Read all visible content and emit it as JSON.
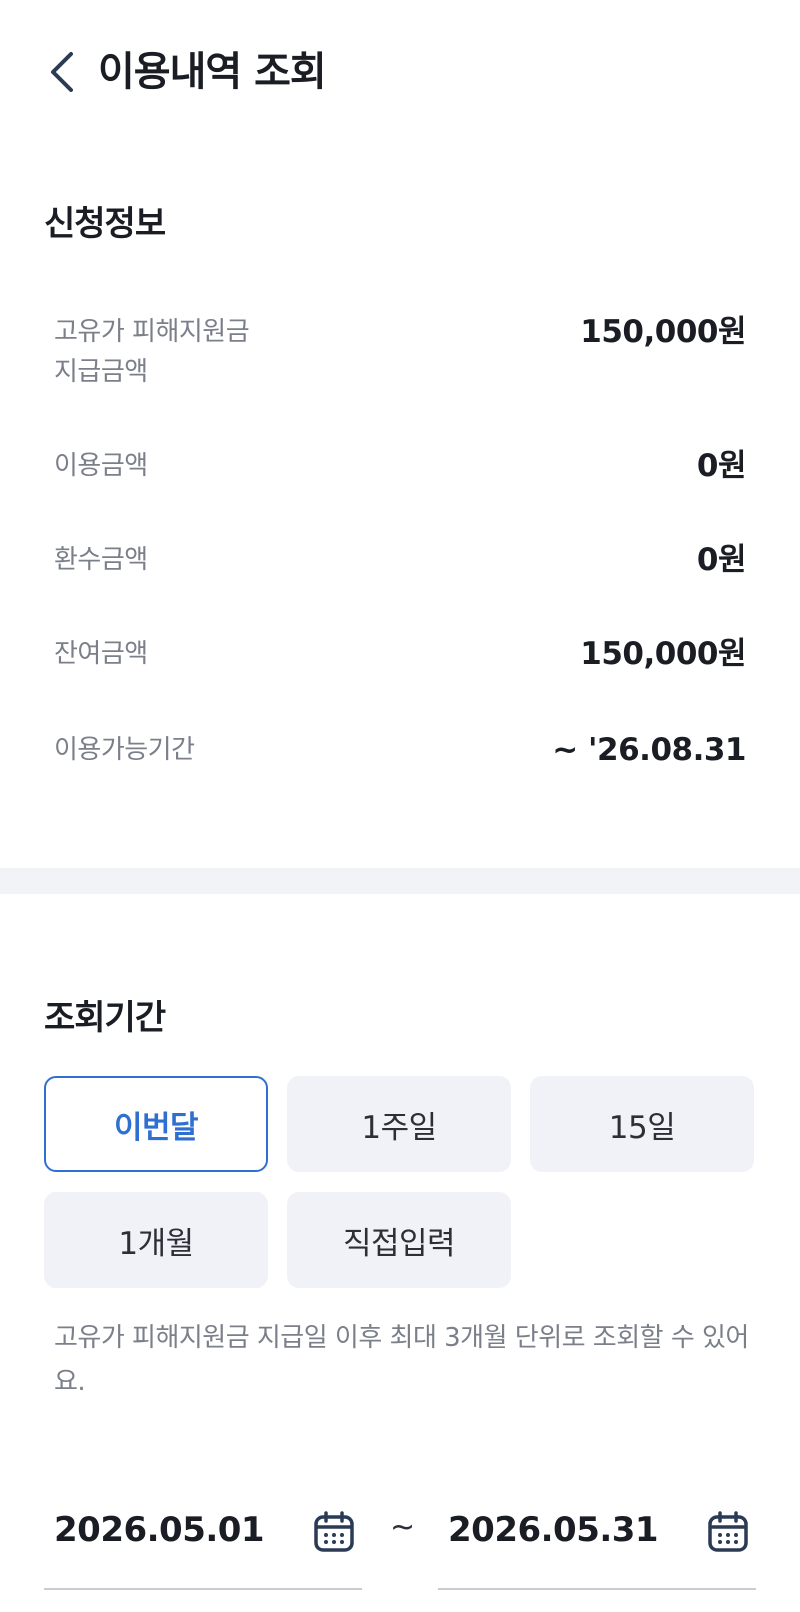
{
  "header": {
    "title": "이용내역 조회",
    "back_icon": "chevron-left-icon"
  },
  "application_info": {
    "title": "신청정보",
    "rows": [
      {
        "label": "고유가 피해지원금\n지급금액",
        "value": "150,000원"
      },
      {
        "label": "이용금액",
        "value": "0원"
      },
      {
        "label": "환수금액",
        "value": "0원"
      },
      {
        "label": "잔여금액",
        "value": "150,000원"
      },
      {
        "label": "이용가능기간",
        "value": "~ '26.08.31"
      }
    ]
  },
  "period": {
    "title": "조회기간",
    "chips": [
      {
        "label": "이번달",
        "selected": true
      },
      {
        "label": "1주일",
        "selected": false
      },
      {
        "label": "15일",
        "selected": false
      },
      {
        "label": "1개월",
        "selected": false
      },
      {
        "label": "직접입력",
        "selected": false
      }
    ],
    "notice": "고유가 피해지원금 지급일 이후 최대 3개월 단위로 조회할 수 있어요.",
    "start_date": "2026.05.01",
    "separator": "~",
    "end_date": "2026.05.31"
  },
  "colors": {
    "accent": "#2f6fd0",
    "chip_bg": "#f1f2f7",
    "label_gray": "#7a7f8a",
    "icon_navy": "#2b3a55"
  }
}
